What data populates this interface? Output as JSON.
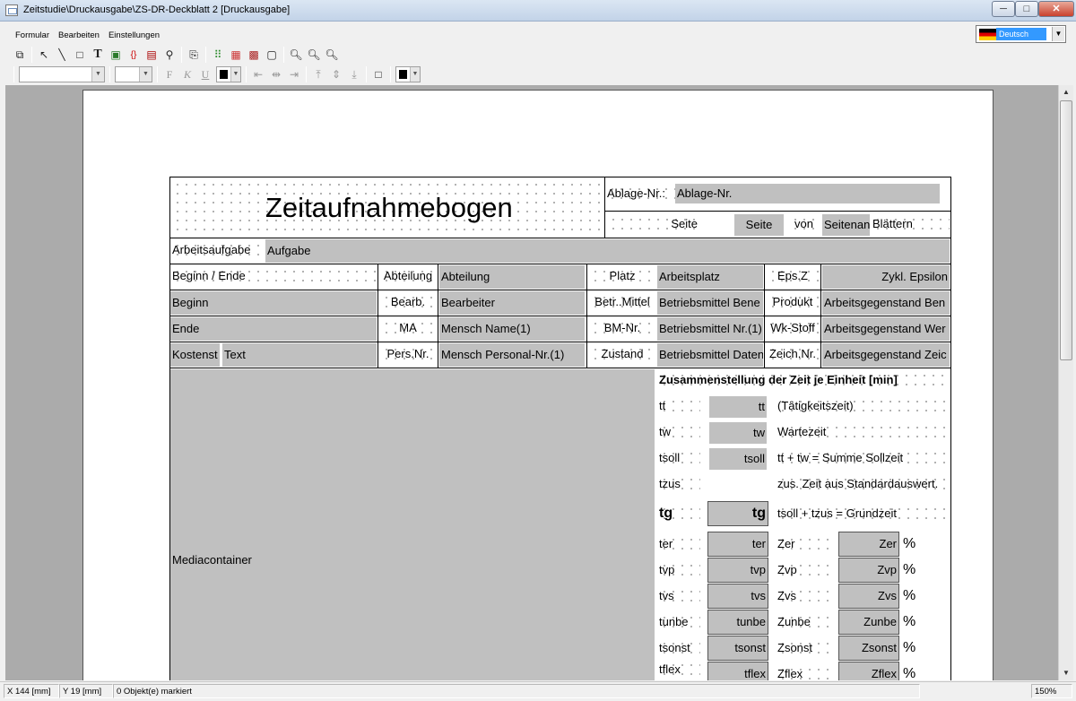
{
  "window": {
    "title": "Zeitstudie\\Druckausgabe\\ZS-DR-Deckblatt 2 [Druckausgabe]",
    "buttons": {
      "minimize": "─",
      "maximize": "□",
      "close": "✕"
    }
  },
  "menu": {
    "items": [
      "Formular",
      "Bearbeiten",
      "Einstellungen"
    ]
  },
  "language": {
    "selected": "Deutsch"
  },
  "toolbar2": {
    "bold_label": "F",
    "italic_label": "K",
    "underline_label": "U"
  },
  "status": {
    "x": "X 144 [mm]",
    "y": "Y 19 [mm]",
    "selection": "0 Objekt(e) markiert",
    "zoom": "150%"
  },
  "form": {
    "title": "Zeitaufnahmebogen",
    "ablage_label": "Ablage-Nr.:",
    "ablage_value": "Ablage-Nr.",
    "seite_label": "Seite",
    "seite_value": "Seite",
    "von_label": "von",
    "seitenanzahl_value": "Seitenan",
    "blaettern_label": "Blättern",
    "arbeitsaufgabe_label": "Arbeitsaufgabe",
    "aufgabe_value": "Aufgabe",
    "row_beginn_ende": "Beginn / Ende",
    "abteilung_label": "Abteilung",
    "abteilung_value": "Abteilung",
    "platz_label": "Platz",
    "arbeitsplatz_value": "Arbeitsplatz",
    "epsz_label": "Eps.Z",
    "zykl_value": "Zykl. Epsilon",
    "beginn_value": "Beginn",
    "bearb_label": "Bearb.",
    "bearbeiter_value": "Bearbeiter",
    "betrmittel_label": "Betr..Mittel",
    "betriebsmittel_bene_value": "Betriebsmittel Bene",
    "produkt_label": "Produkt",
    "arbeitsgegenstand_ben_value": "Arbeitsgegenstand Ben",
    "ende_value": "Ende",
    "ma_label": "MA",
    "mensch_name_value": "Mensch Name(1)",
    "bmnr_label": "BM-Nr.",
    "betriebsmittel_nr_value": "Betriebsmittel Nr.(1)",
    "wkstoff_label": "Wk-Stoff",
    "arbeitsgegenstand_wer_value": "Arbeitsgegenstand Wer",
    "kostenst_value": "Kostenst",
    "text_value": "Text",
    "persnr_label": "Pers.Nr.",
    "mensch_personal_value": "Mensch Personal-Nr.(1)",
    "zustand_label": "Zustand",
    "betriebsmittel_daten_value": "Betriebsmittel Daten",
    "zeichnr_label": "Zeich.Nr.",
    "arbeitsgegenstand_zeic_value": "Arbeitsgegenstand Zeic",
    "mediacontainer_label": "Mediacontainer",
    "summary_title": "Zusammenstellung der Zeit je Einheit  [min]",
    "tt_label": "tt",
    "tt_value": "tt",
    "tt_desc": "(Tätigkeitszeit)",
    "tw_label": "tw",
    "tw_value": "tw",
    "tw_desc": "Wartezeit",
    "tsoll_label": "tsoll",
    "tsoll_value": "tsoll",
    "tsoll_desc": "tt + tw = Summe Sollzeit",
    "tzus_label": "tzus",
    "tzus_desc": "zus. Zeit aus Standardauswert.",
    "tg_label": "tg",
    "tg_value": "tg",
    "tg_desc": "tsoll + tzus = Grundzeit",
    "rows": [
      {
        "l": "ter",
        "v": "ter",
        "zl": "Zer",
        "zv": "Zer",
        "pct": "%"
      },
      {
        "l": "tvp",
        "v": "tvp",
        "zl": "Zvp",
        "zv": "Zvp",
        "pct": "%"
      },
      {
        "l": "tvs",
        "v": "tvs",
        "zl": "Zvs",
        "zv": "Zvs",
        "pct": "%"
      },
      {
        "l": "tunbe",
        "v": "tunbe",
        "zl": "Zunbe",
        "zv": "Zunbe",
        "pct": "%"
      },
      {
        "l": "tsonst",
        "v": "tsonst",
        "zl": "Zsonst",
        "zv": "Zsonst",
        "pct": "%"
      },
      {
        "l": "tflex",
        "v": "tflex",
        "zl": "Zflex",
        "zv": "Zflex",
        "pct": "%"
      }
    ]
  }
}
